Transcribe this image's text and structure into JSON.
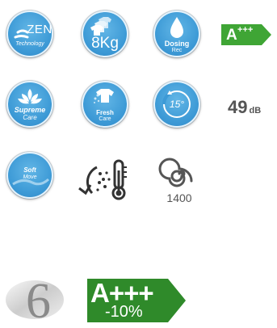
{
  "row1": {
    "zen": {
      "icon": "zen-logo-icon",
      "title": "ZEN",
      "subtitle": "Technology"
    },
    "capacity": {
      "icon": "shirt-stack-icon",
      "label": "8Kg"
    },
    "dosing": {
      "icon": "drop-icon",
      "title": "Dosing",
      "subtitle": "Rec"
    },
    "energy_label": {
      "text": "A",
      "sup": "+++"
    }
  },
  "row2": {
    "supreme": {
      "icon": "lotus-icon",
      "title": "Supreme",
      "subtitle": "Care"
    },
    "fresh": {
      "icon": "fresh-shirt-icon",
      "title": "Fresh",
      "subtitle": "Care"
    },
    "temp": {
      "icon": "fifteen-degree-icon",
      "label": "15°"
    },
    "noise": {
      "value": "49",
      "unit": "dB"
    }
  },
  "row3": {
    "soft": {
      "icon": "soft-move-icon",
      "title": "Soft",
      "subtitle": "Move"
    },
    "steam": {
      "icon": "steam-thermometer-icon"
    },
    "spin": {
      "icon": "spin-spiral-icon",
      "label": "1400"
    }
  },
  "row4": {
    "six": {
      "icon": "six-motion-icon",
      "label": "6"
    },
    "energy_big": {
      "text": "A+++",
      "sub": "-10%"
    }
  },
  "colors": {
    "badge_blue": "#3d9ad6",
    "energy_green": "#3fa535",
    "energy_dark_green": "#2f8a2a",
    "grey_text": "#555555"
  }
}
